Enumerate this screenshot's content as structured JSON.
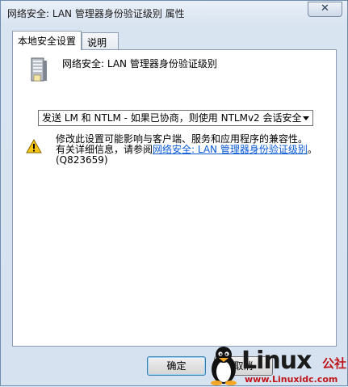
{
  "window": {
    "title": "网络安全: LAN 管理器身份验证级别 属性",
    "close_label": "✕"
  },
  "tabs": [
    {
      "label": "本地安全设置",
      "active": true
    },
    {
      "label": "说明",
      "active": false
    }
  ],
  "policy": {
    "title": "网络安全: LAN 管理器身份验证级别"
  },
  "select": {
    "value": "发送 LM 和 NTLM - 如果已协商，则使用 NTLMv2 会话安全"
  },
  "warning": {
    "line1": "修改此设置可能影响与客户端、服务和应用程序的兼容性。",
    "line2_prefix": "有关详细信息，请参阅",
    "link": "网络安全: LAN 管理器身份验证级别",
    "line2_suffix": "。",
    "line3": "(Q823659)"
  },
  "buttons": {
    "ok": "确定",
    "cancel": "取消"
  },
  "watermark": {
    "word": "Linux",
    "cn": "公社",
    "url": "www.Linuxidc.com"
  },
  "colors": {
    "link": "#0b5bd6",
    "watermark_red": "#c0161b"
  }
}
